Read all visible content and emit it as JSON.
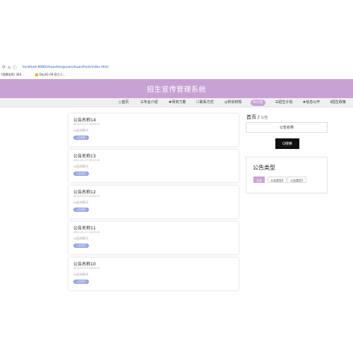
{
  "browser": {
    "nav_icons": [
      "⟳",
      "⌂",
      "ⓘ"
    ],
    "url": "localhost:8080/zhaoshengxuanchuan/front/index.html",
    "bookmarks": [
      "[招聘信息] 360...",
      "Day01-09-用工介..."
    ]
  },
  "header": {
    "title": "招生宣传管理系统"
  },
  "nav": {
    "items": [
      {
        "icon": "○",
        "label": "首页"
      },
      {
        "icon": "☰",
        "label": "专业介绍"
      },
      {
        "icon": "❀",
        "label": "师资力量"
      },
      {
        "icon": "☐",
        "label": "联系方式"
      },
      {
        "icon": "◎",
        "label": "校训校规"
      },
      {
        "icon": "☒",
        "label": "公告"
      },
      {
        "icon": "☰",
        "label": "招生计划"
      },
      {
        "icon": "❀",
        "label": "信息公开"
      },
      {
        "icon": "ℹ",
        "label": "招生政策"
      }
    ],
    "active_index": 5,
    "active_color": "#c8a2d4"
  },
  "notices": [
    {
      "title": "公告名称14",
      "date": "2021-05-27 16:09:49",
      "desc": "公告详情14",
      "tag": "公告类型1"
    },
    {
      "title": "公告名称13",
      "date": "2021-05-27 16:09:49",
      "desc": "公告详情13",
      "tag": "公告类型1"
    },
    {
      "title": "公告名称12",
      "date": "2021-05-27 16:09:49",
      "desc": "公告详情12",
      "tag": "公告类型1"
    },
    {
      "title": "公告名称11",
      "date": "2021-05-27 16:09:49",
      "desc": "公告详情11",
      "tag": "公告类型1"
    },
    {
      "title": "公告名称10",
      "date": "2021-05-27 16:09:49",
      "desc": "公告详情10",
      "tag": "公告类型1"
    }
  ],
  "sidebar": {
    "breadcrumb_home": "首页",
    "breadcrumb_sep": "/",
    "breadcrumb_current": "公告",
    "search_placeholder": "公告名称",
    "search_button": "Q搜索",
    "types_title": "公告类型",
    "types": [
      "全部",
      "公告类型2",
      "公告类型1"
    ],
    "types_active_index": 0
  }
}
